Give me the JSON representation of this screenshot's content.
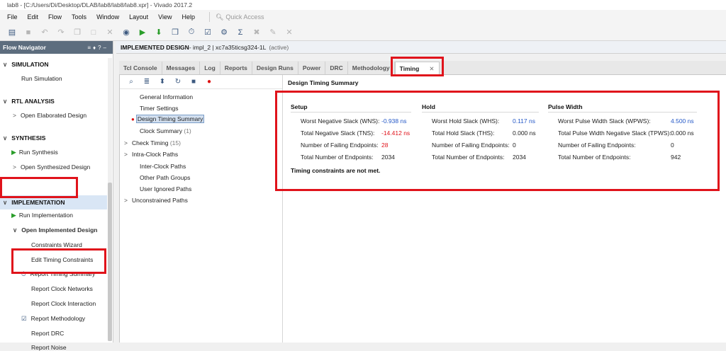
{
  "window": {
    "title": "lab8 - [C:/Users/Di/Desktop/DLAB/lab8/lab8/lab8.xpr] - Vivado 2017.2"
  },
  "menu": {
    "items": [
      "File",
      "Edit",
      "Flow",
      "Tools",
      "Window",
      "Layout",
      "View",
      "Help"
    ],
    "quick_access": "Quick Access"
  },
  "flow_navigator": {
    "title": "Flow Navigator",
    "sections": {
      "simulation": "SIMULATION",
      "rtl": "RTL ANALYSIS",
      "synthesis": "SYNTHESIS",
      "implementation": "IMPLEMENTATION"
    },
    "items": {
      "run_simulation": "Run Simulation",
      "open_elaborated": "Open Elaborated Design",
      "run_synthesis": "Run Synthesis",
      "open_synthesized": "Open Synthesized Design",
      "run_implementation": "Run Implementation",
      "open_implemented": "Open Implemented Design",
      "constraints_wizard": "Constraints Wizard",
      "edit_timing": "Edit Timing Constraints",
      "report_timing_summary": "Report Timing Summary",
      "report_clock_networks": "Report Clock Networks",
      "report_clock_interaction": "Report Clock Interaction",
      "report_methodology": "Report Methodology",
      "report_drc": "Report DRC",
      "report_noise": "Report Noise"
    }
  },
  "design_header": {
    "title": "IMPLEMENTED DESIGN",
    "detail": " - impl_2 | xc7a35ticsg324-1L",
    "status": "(active)"
  },
  "tabs": [
    "Tcl Console",
    "Messages",
    "Log",
    "Reports",
    "Design Runs",
    "Power",
    "DRC",
    "Methodology",
    "Timing"
  ],
  "tree": {
    "general_information": "General Information",
    "timer_settings": "Timer Settings",
    "design_timing_summary": "Design Timing Summary",
    "clock_summary": "Clock Summary",
    "clock_summary_count": "(1)",
    "check_timing": "Check Timing",
    "check_timing_count": "(15)",
    "intra_clock": "Intra-Clock Paths",
    "inter_clock": "Inter-Clock Paths",
    "other_path_groups": "Other Path Groups",
    "user_ignored": "User Ignored Paths",
    "unconstrained": "Unconstrained Paths"
  },
  "summary": {
    "title": "Design Timing Summary",
    "setup": {
      "header": "Setup",
      "wns_label": "Worst Negative Slack (WNS):",
      "wns": "-0.938 ns",
      "tns_label": "Total Negative Slack (TNS):",
      "tns": "-14.412 ns",
      "fail_label": "Number of Failing Endpoints:",
      "fail": "28",
      "total_label": "Total Number of Endpoints:",
      "total": "2034"
    },
    "hold": {
      "header": "Hold",
      "whs_label": "Worst Hold Slack (WHS):",
      "whs": "0.117 ns",
      "ths_label": "Total Hold Slack (THS):",
      "ths": "0.000 ns",
      "fail_label": "Number of Failing Endpoints:",
      "fail": "0",
      "total_label": "Total Number of Endpoints:",
      "total": "2034"
    },
    "pulse": {
      "header": "Pulse Width",
      "wpws_label": "Worst Pulse Width Slack (WPWS):",
      "wpws": "4.500 ns",
      "tpws_label": "Total Pulse Width Negative Slack (TPWS):",
      "tpws": "0.000 ns",
      "fail_label": "Number of Failing Endpoints:",
      "fail": "0",
      "total_label": "Total Number of Endpoints:",
      "total": "942"
    },
    "note": "Timing constraints are not met."
  }
}
